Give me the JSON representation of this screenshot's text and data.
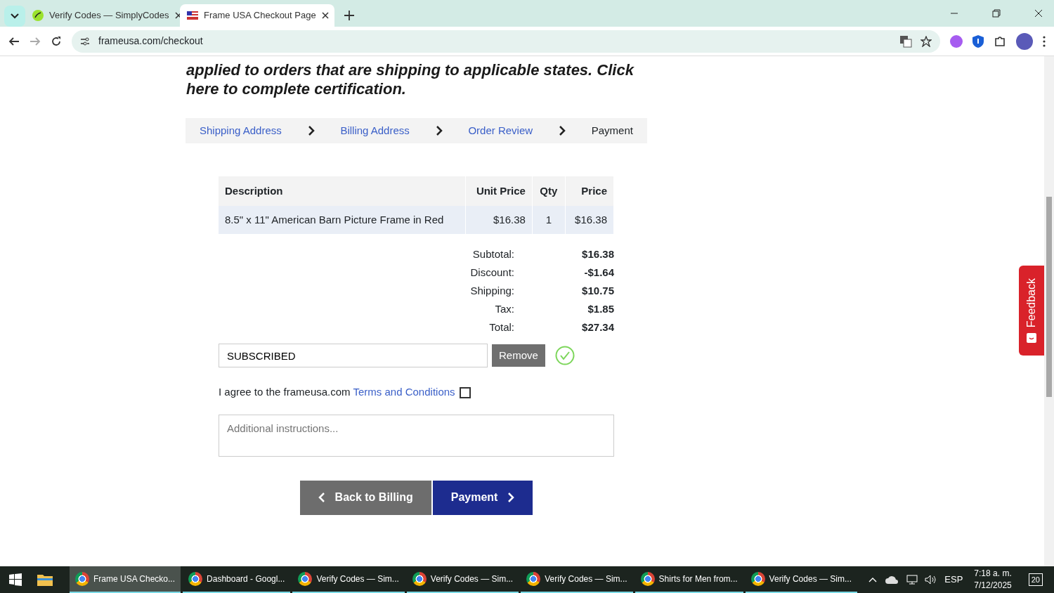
{
  "browser": {
    "tabs": [
      {
        "title": "Verify Codes — SimplyCodes",
        "selected": false
      },
      {
        "title": "Frame USA Checkout Page",
        "selected": true
      }
    ],
    "url": "frameusa.com/checkout"
  },
  "page": {
    "notice": "applied to orders that are shipping to applicable states. Click here to complete certification.",
    "steps": [
      {
        "label": "Shipping Address",
        "kind": "link"
      },
      {
        "label": "Billing Address",
        "kind": "link"
      },
      {
        "label": "Order Review",
        "kind": "link"
      },
      {
        "label": "Payment",
        "kind": "current"
      }
    ],
    "table": {
      "columns": [
        "Description",
        "Unit Price",
        "Qty",
        "Price"
      ],
      "rows": [
        [
          "8.5\" x 11\" American Barn Picture Frame in Red",
          "$16.38",
          "1",
          "$16.38"
        ]
      ]
    },
    "summary": [
      {
        "label": "Subtotal:",
        "value": "$16.38"
      },
      {
        "label": "Discount:",
        "value": "-$1.64"
      },
      {
        "label": "Shipping:",
        "value": "$10.75"
      },
      {
        "label": "Tax:",
        "value": "$1.85"
      },
      {
        "label": "Total:",
        "value": "$27.34"
      }
    ],
    "coupon": {
      "value": "SUBSCRIBED",
      "button": "Remove",
      "applied": true
    },
    "terms": {
      "text": "I agree to the frameusa.com",
      "link": "Terms and Conditions",
      "checked": false
    },
    "instructions": {
      "placeholder": "Additional instructions..."
    },
    "buttons": [
      {
        "label": "Back to Billing",
        "kind": "back"
      },
      {
        "label": "Payment",
        "kind": "next"
      }
    ],
    "feedback": "Feedback"
  },
  "taskbar": {
    "items": [
      {
        "label": "Frame USA Checko...",
        "selected": true
      },
      {
        "label": "Dashboard - Googl...",
        "selected": false
      },
      {
        "label": "Verify Codes — Sim...",
        "selected": false
      },
      {
        "label": "Verify Codes — Sim...",
        "selected": false
      },
      {
        "label": "Verify Codes — Sim...",
        "selected": false
      },
      {
        "label": "Shirts for Men from...",
        "selected": false
      },
      {
        "label": "Verify Codes — Sim...",
        "selected": false
      }
    ],
    "language": "ESP",
    "time": "7:18 a. m.",
    "date": "7/12/2025",
    "notifications": "20"
  }
}
